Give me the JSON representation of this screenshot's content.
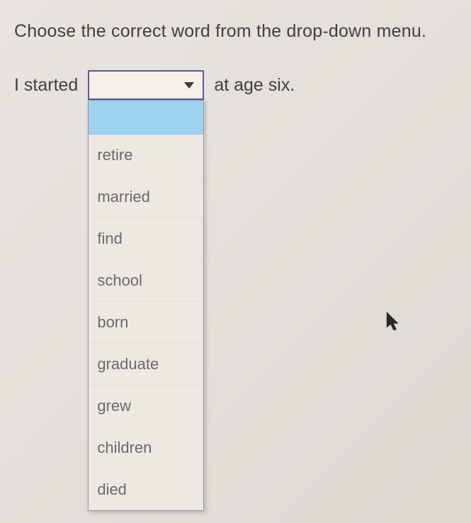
{
  "question": {
    "instruction": "Choose the correct word from the drop-down menu.",
    "textBefore": "I started",
    "textAfter": "at age six."
  },
  "dropdown": {
    "selectedValue": "",
    "options": {
      "blank": "",
      "opt0": "retire",
      "opt1": "married",
      "opt2": "find",
      "opt3": "school",
      "opt4": "born",
      "opt5": "graduate",
      "opt6": "grew",
      "opt7": "children",
      "opt8": "died"
    }
  }
}
